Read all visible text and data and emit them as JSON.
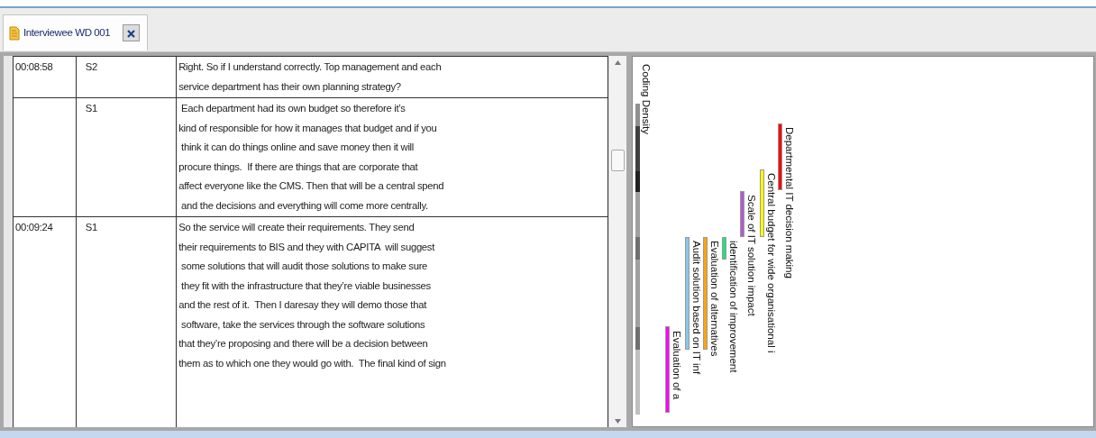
{
  "tabs": [
    {
      "label": "Interviewee WD 001",
      "selected": true
    }
  ],
  "transcript": {
    "rows": [
      {
        "time": "00:08:58",
        "speaker": "S2",
        "lines": [
          "Right. So if I understand correctly. Top management and each",
          "service department has their own planning strategy?"
        ]
      },
      {
        "speaker": "S1",
        "lines": [
          " Each department had its own budget so therefore it’s",
          "kind of responsible for how it manages that budget and if you",
          " think it can do things online and save money then it will",
          "procure things.  If there are things that are corporate that",
          "affect everyone like the CMS. Then that will be a central spend",
          " and the decisions and everything will come more centrally."
        ]
      },
      {
        "time": "00:09:24",
        "speaker": "S1",
        "lines": [
          "So the service will create their requirements. They send",
          "their requirements to BIS and they with CAPITA  will suggest",
          " some solutions that will audit those solutions to make sure",
          " they fit with the infrastructure that they’re viable businesses",
          "and the rest of it.  Then I daresay they will demo those that",
          " software, take the services through the software solutions",
          "that they’re proposing and there will be a decision between",
          "them as to which one they would go with.  The final kind of sign"
        ]
      }
    ]
  },
  "coding_stripes": {
    "density_label": "Coding Density",
    "stripes": [
      {
        "label": "Departmental IT decision making",
        "color": "#ff0000"
      },
      {
        "label": "Central budget for wide organisational i",
        "color": "#ffff00"
      },
      {
        "label": "Scale of IT solution impact",
        "color": "#b05cd0"
      },
      {
        "label": "identification of improvement",
        "color": "#22e07a"
      },
      {
        "label": "Evaluation of alternatives",
        "color": "#ffa500"
      },
      {
        "label": "Audit solution based on IT inf",
        "color": "#87c8e8"
      },
      {
        "label": "Evaluation of a",
        "color": "#ff00ff"
      }
    ]
  }
}
